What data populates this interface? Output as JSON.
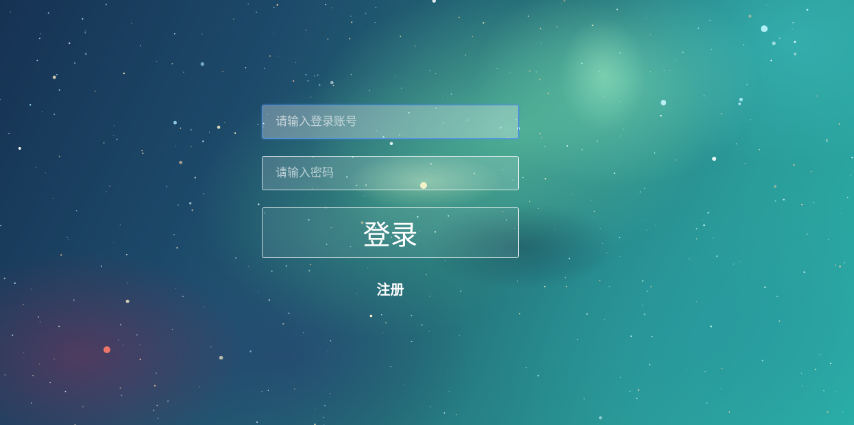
{
  "login": {
    "username_placeholder": "请输入登录账号",
    "username_value": "",
    "password_placeholder": "请输入密码",
    "password_value": "",
    "login_button_label": "登录",
    "register_link_label": "注册"
  },
  "background": {
    "theme": "nebula-starfield",
    "accent_colors": [
      "#163253",
      "#24727a",
      "#2ab0a8",
      "#7fe0b0"
    ]
  },
  "colors": {
    "focus_border": "#4f8fe0",
    "text": "#ffffff"
  }
}
